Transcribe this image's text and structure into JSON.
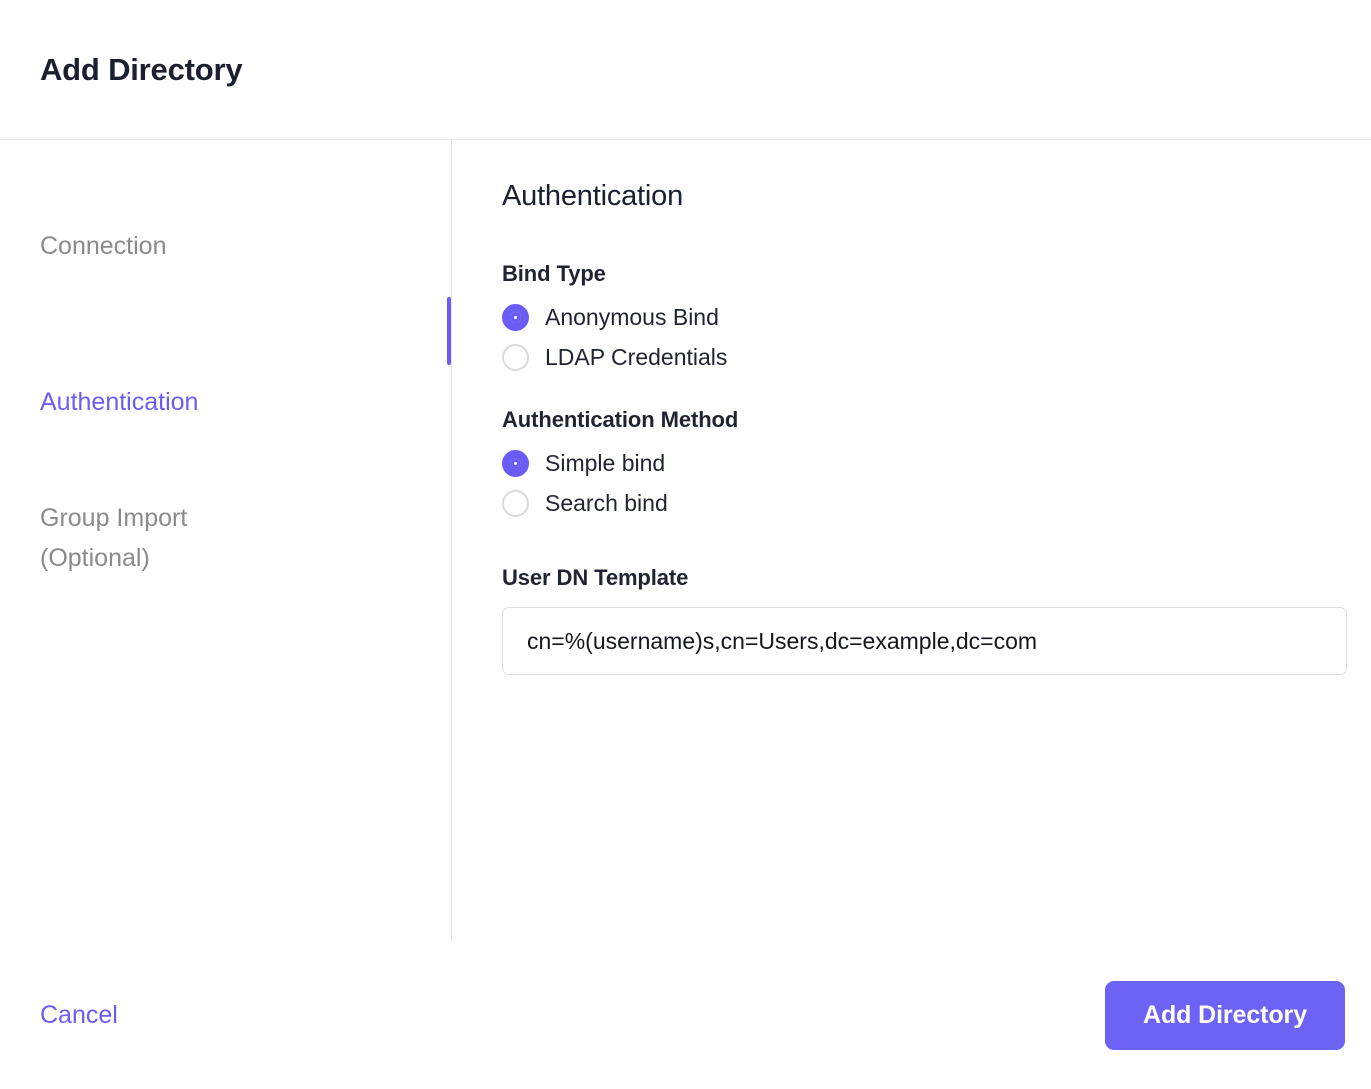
{
  "header": {
    "title": "Add Directory"
  },
  "sidebar": {
    "items": [
      {
        "label": "Connection",
        "active": false
      },
      {
        "label": "Authentication",
        "active": true
      },
      {
        "label": "Group Import\n(Optional)",
        "active": false
      }
    ]
  },
  "main": {
    "section_title": "Authentication",
    "bind_type": {
      "label": "Bind Type",
      "options": [
        {
          "label": "Anonymous Bind",
          "selected": true
        },
        {
          "label": "LDAP Credentials",
          "selected": false
        }
      ]
    },
    "auth_method": {
      "label": "Authentication Method",
      "options": [
        {
          "label": "Simple bind",
          "selected": true
        },
        {
          "label": "Search bind",
          "selected": false
        }
      ]
    },
    "user_dn_template": {
      "label": "User DN Template",
      "value": "cn=%(username)s,cn=Users,dc=example,dc=com",
      "placeholder": "cn=%(username)s,cn=Users,dc=example,dc=com"
    }
  },
  "footer": {
    "cancel_label": "Cancel",
    "submit_label": "Add Directory"
  },
  "colors": {
    "accent": "#6c5cf7",
    "primary_button": "#6c63f5",
    "text_dark": "#1f2430",
    "text_muted": "#8a8a8e",
    "border": "#e6e8eb"
  }
}
